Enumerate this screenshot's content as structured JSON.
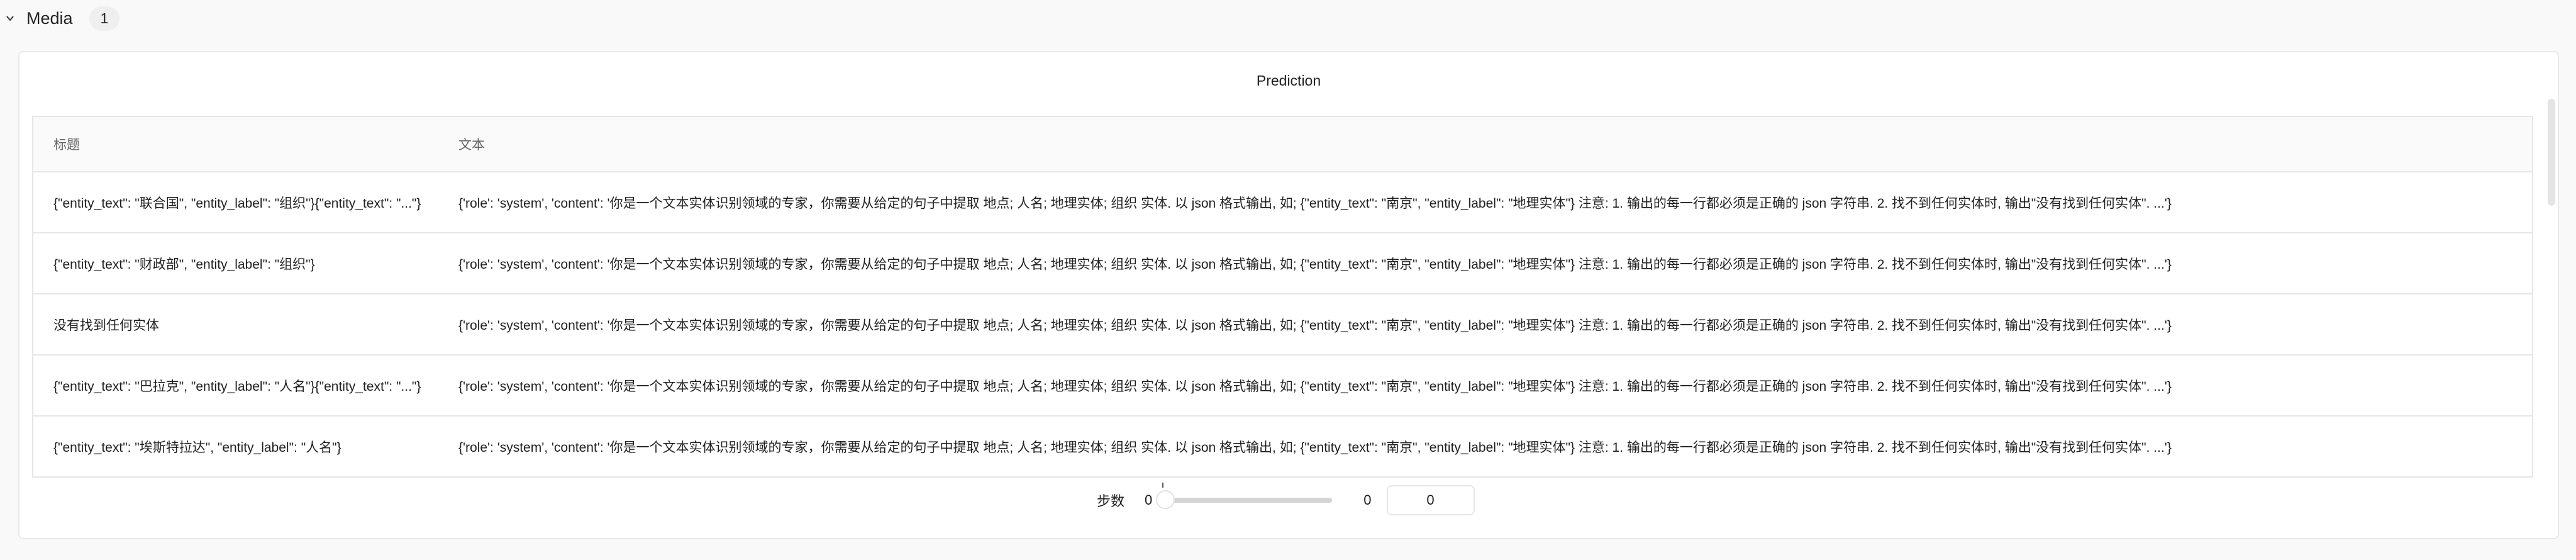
{
  "section": {
    "title": "Media",
    "count": "1",
    "icon": "chevron-down-icon"
  },
  "panel": {
    "title": "Prediction"
  },
  "table": {
    "headers": [
      "标题",
      "文本"
    ],
    "rows": [
      {
        "title": "{\"entity_text\": \"联合国\", \"entity_label\": \"组织\"}{\"entity_text\": \"...\"}",
        "text": "{'role': 'system', 'content': '你是一个文本实体识别领域的专家，你需要从给定的句子中提取 地点; 人名; 地理实体; 组织 实体. 以 json 格式输出, 如; {\"entity_text\": \"南京\", \"entity_label\": \"地理实体\"} 注意: 1. 输出的每一行都必须是正确的 json 字符串. 2. 找不到任何实体时, 输出\"没有找到任何实体\". ...'}"
      },
      {
        "title": "{\"entity_text\": \"财政部\", \"entity_label\": \"组织\"}",
        "text": "{'role': 'system', 'content': '你是一个文本实体识别领域的专家，你需要从给定的句子中提取 地点; 人名; 地理实体; 组织 实体. 以 json 格式输出, 如; {\"entity_text\": \"南京\", \"entity_label\": \"地理实体\"} 注意: 1. 输出的每一行都必须是正确的 json 字符串. 2. 找不到任何实体时, 输出\"没有找到任何实体\". ...'}"
      },
      {
        "title": "没有找到任何实体",
        "text": "{'role': 'system', 'content': '你是一个文本实体识别领域的专家，你需要从给定的句子中提取 地点; 人名; 地理实体; 组织 实体. 以 json 格式输出, 如; {\"entity_text\": \"南京\", \"entity_label\": \"地理实体\"} 注意: 1. 输出的每一行都必须是正确的 json 字符串. 2. 找不到任何实体时, 输出\"没有找到任何实体\". ...'}"
      },
      {
        "title": "{\"entity_text\": \"巴拉克\", \"entity_label\": \"人名\"}{\"entity_text\": \"...\"}",
        "text": "{'role': 'system', 'content': '你是一个文本实体识别领域的专家，你需要从给定的句子中提取 地点; 人名; 地理实体; 组织 实体. 以 json 格式输出, 如; {\"entity_text\": \"南京\", \"entity_label\": \"地理实体\"} 注意: 1. 输出的每一行都必须是正确的 json 字符串. 2. 找不到任何实体时, 输出\"没有找到任何实体\". ...'}"
      },
      {
        "title": "{\"entity_text\": \"埃斯特拉达\", \"entity_label\": \"人名\"}",
        "text": "{'role': 'system', 'content': '你是一个文本实体识别领域的专家，你需要从给定的句子中提取 地点; 人名; 地理实体; 组织 实体. 以 json 格式输出, 如; {\"entity_text\": \"南京\", \"entity_label\": \"地理实体\"} 注意: 1. 输出的每一行都必须是正确的 json 字符串. 2. 找不到任何实体时, 输出\"没有找到任何实体\". ...'}"
      }
    ]
  },
  "step": {
    "label": "步数",
    "min": "0",
    "max": "0",
    "value": "0"
  }
}
